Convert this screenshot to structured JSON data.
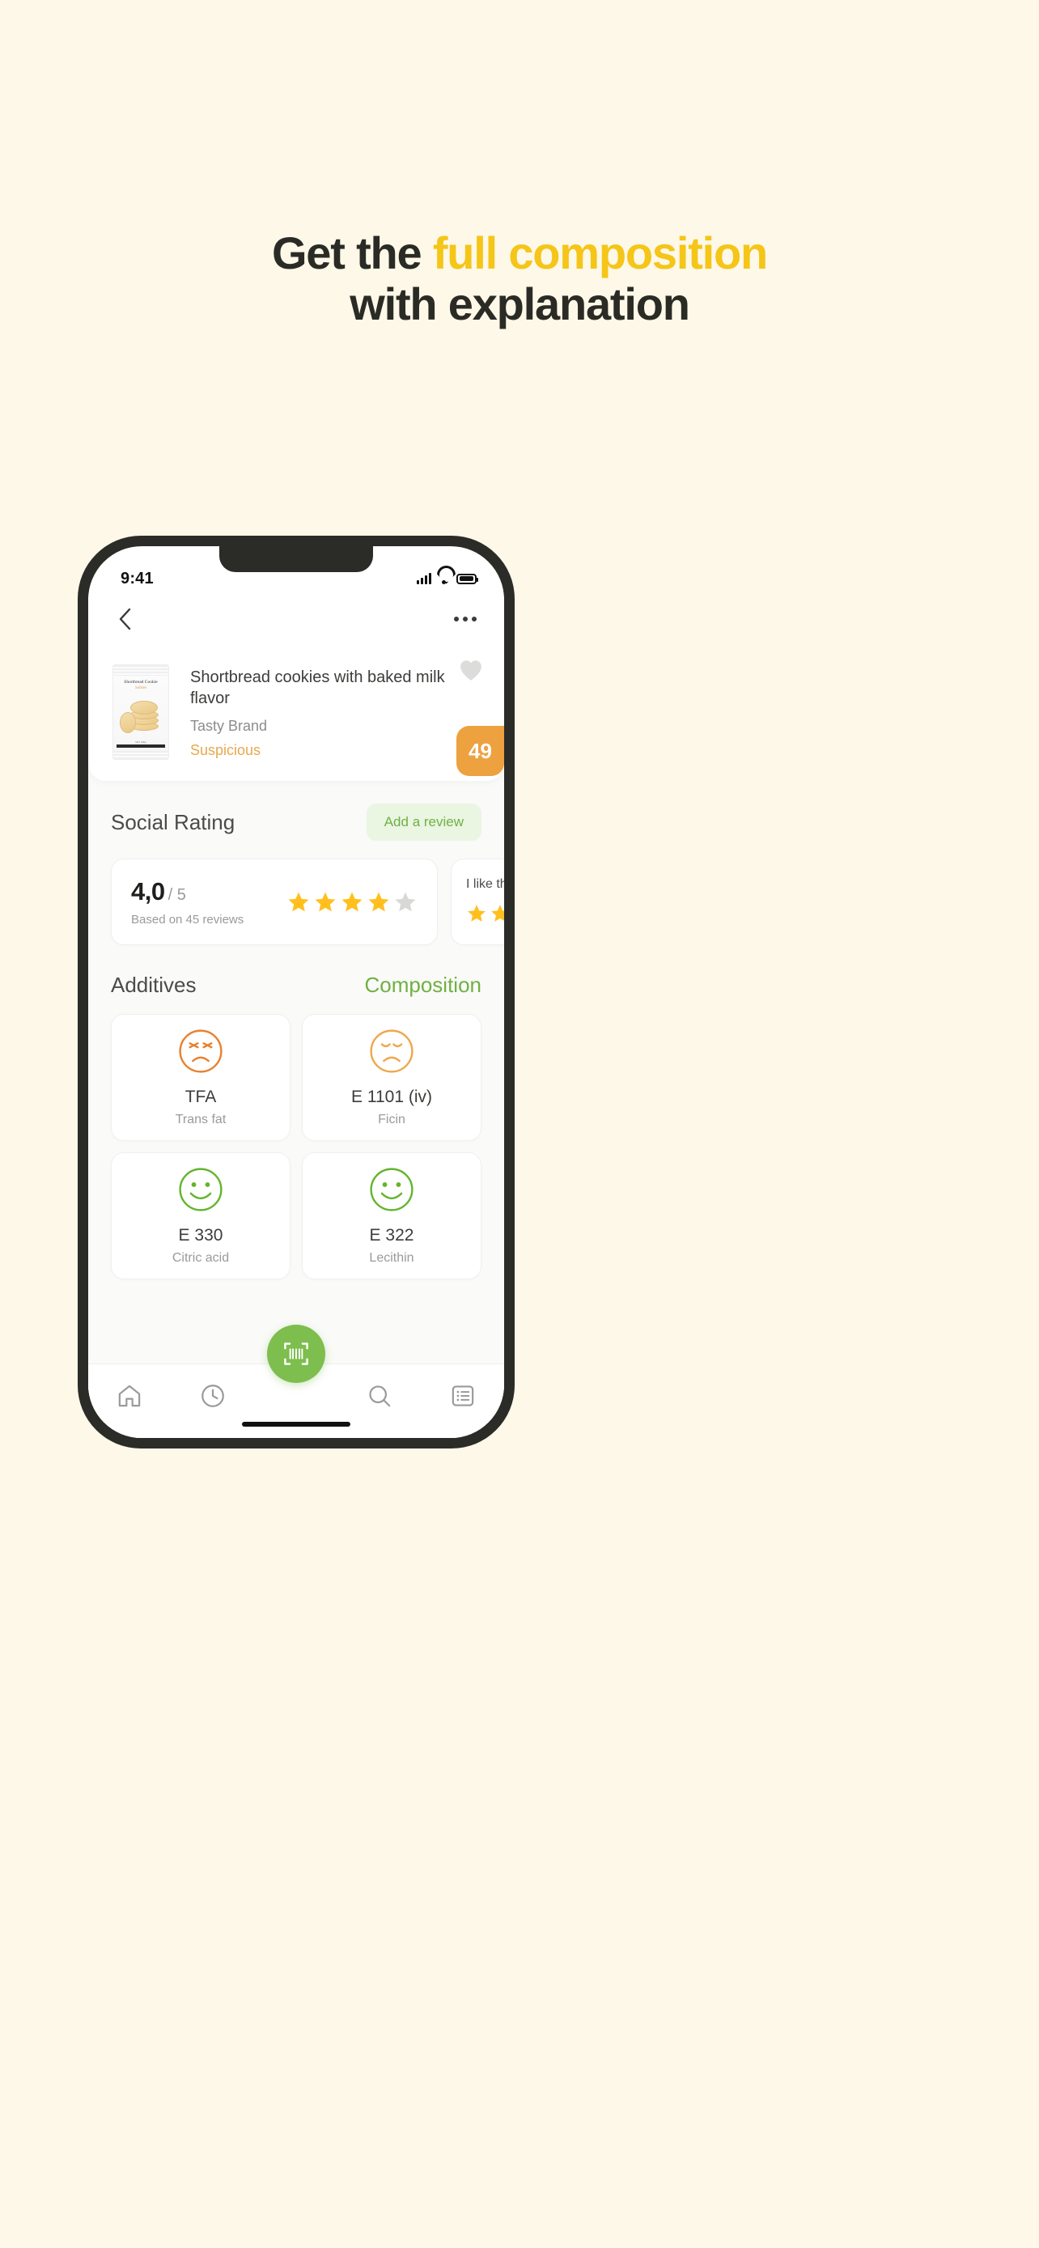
{
  "promo": {
    "line1_prefix": "Get the ",
    "line1_highlight": "full composition",
    "line2": "with explanation",
    "accent_color": "#F5C518",
    "text_color": "#2B2B26",
    "background_color": "#FDF8E8"
  },
  "status_bar": {
    "time": "9:41",
    "signal_icon": "cellular-bars-icon",
    "wifi_icon": "wifi-icon",
    "battery_icon": "battery-full-icon"
  },
  "nav": {
    "back_icon": "chevron-left-icon",
    "more_icon": "ellipsis-icon"
  },
  "product": {
    "package_label_top": "Shortbread Cookie",
    "package_label_sub": "Sablés",
    "title": "Shortbread cookies with baked milk flavor",
    "brand": "Tasty Brand",
    "status": "Suspicious",
    "status_color": "#E8A84D",
    "score": "49",
    "score_color": "#EDA13F",
    "favorite_icon": "heart-icon"
  },
  "social": {
    "title": "Social Rating",
    "add_review_label": "Add a review",
    "add_review_color": "#6FB142",
    "rating_value": "4,0",
    "rating_max": "/ 5",
    "rating_based_on": "Based on 45 reviews",
    "stars_filled": 4,
    "stars_total": 5,
    "star_color": "#FFC01E",
    "star_empty_color": "#D8D8D6",
    "next_review_text": "I like this favor",
    "next_review_stars_filled": 5
  },
  "tabs": {
    "additives_label": "Additives",
    "composition_label": "Composition",
    "active": "Composition"
  },
  "additives": [
    {
      "code": "TFA",
      "name": "Trans fat",
      "face": "very-bad",
      "color": "#E8812E"
    },
    {
      "code": "E 1101 (iv)",
      "name": "Ficin",
      "face": "bad",
      "color": "#EFA74B"
    },
    {
      "code": "E 330",
      "name": "Citric acid",
      "face": "good",
      "color": "#64B42D"
    },
    {
      "code": "E 322",
      "name": "Lecithin",
      "face": "good",
      "color": "#64B42D"
    }
  ],
  "tabbar": {
    "items": [
      {
        "icon": "home-icon",
        "label": "Home"
      },
      {
        "icon": "history-icon",
        "label": "History"
      },
      {
        "icon": "search-icon",
        "label": "Search"
      },
      {
        "icon": "list-icon",
        "label": "Lists"
      }
    ],
    "scan_icon": "barcode-scan-icon",
    "scan_color": "#7DBE4F"
  }
}
